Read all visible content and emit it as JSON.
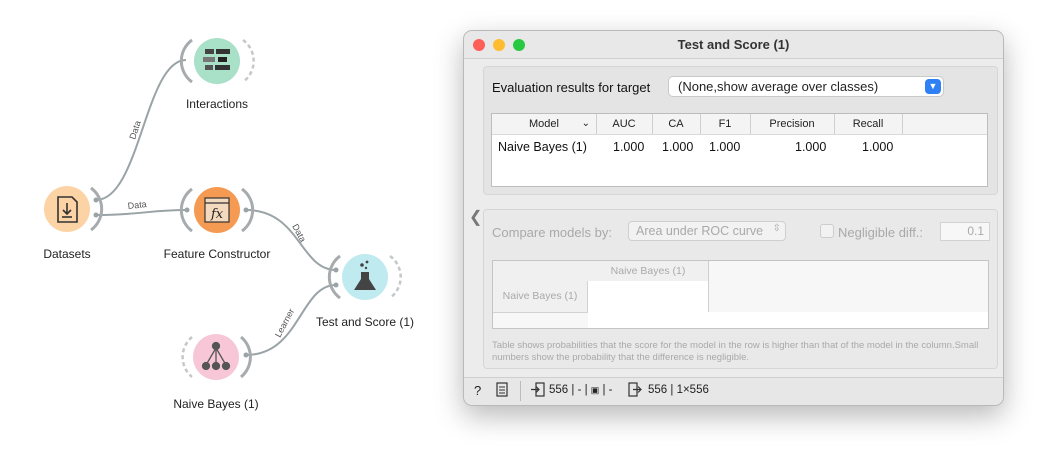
{
  "canvas": {
    "nodes": {
      "interactions": {
        "label": "Interactions",
        "color": "#a8e0c8",
        "icon": "interactions-icon"
      },
      "datasets": {
        "label": "Datasets",
        "color": "#fcd3a5",
        "icon": "download-file-icon"
      },
      "feature_constructor": {
        "label": "Feature Constructor",
        "color": "#f59a52",
        "icon": "function-fx-icon"
      },
      "test_and_score": {
        "label": "Test and Score (1)",
        "color": "#bfeaf0",
        "icon": "flask-icon"
      },
      "naive_bayes": {
        "label": "Naive Bayes (1)",
        "color": "#f7c7d8",
        "icon": "network-graph-icon"
      }
    },
    "links": {
      "datasets_interactions": "Data",
      "datasets_feature": "Data",
      "feature_test": "Data",
      "naive_test": "Learner"
    }
  },
  "window": {
    "title": "Test and Score (1)",
    "target_label": "Evaluation results for target",
    "target_value": "(None,show average over classes)",
    "results_table": {
      "headers": [
        "Model",
        "AUC",
        "CA",
        "F1",
        "Precision",
        "Recall"
      ],
      "rows": [
        {
          "model": "Naive Bayes (1)",
          "auc": "1.000",
          "ca": "1.000",
          "f1": "1.000",
          "precision": "1.000",
          "recall": "1.000"
        }
      ]
    },
    "compare_label": "Compare models by:",
    "compare_value": "Area under ROC curve",
    "negligible_label": "Negligible diff.:",
    "negligible_value": "0.1",
    "compare_table": {
      "col_header": "Naive Bayes (1)",
      "row_header": "Naive Bayes (1)"
    },
    "note": "Table shows probabilities that the score for the model in the row is higher than that of the model in the column.Small numbers show the probability that the difference is negligible.",
    "status": {
      "input_count": "556 | - | ",
      "input_tail": " | -",
      "output": "556 | 1×556"
    },
    "colors": {
      "accent": "#2f7ff5",
      "close": "#fe5f57",
      "minimize": "#febc2e",
      "zoom": "#28c840"
    }
  }
}
